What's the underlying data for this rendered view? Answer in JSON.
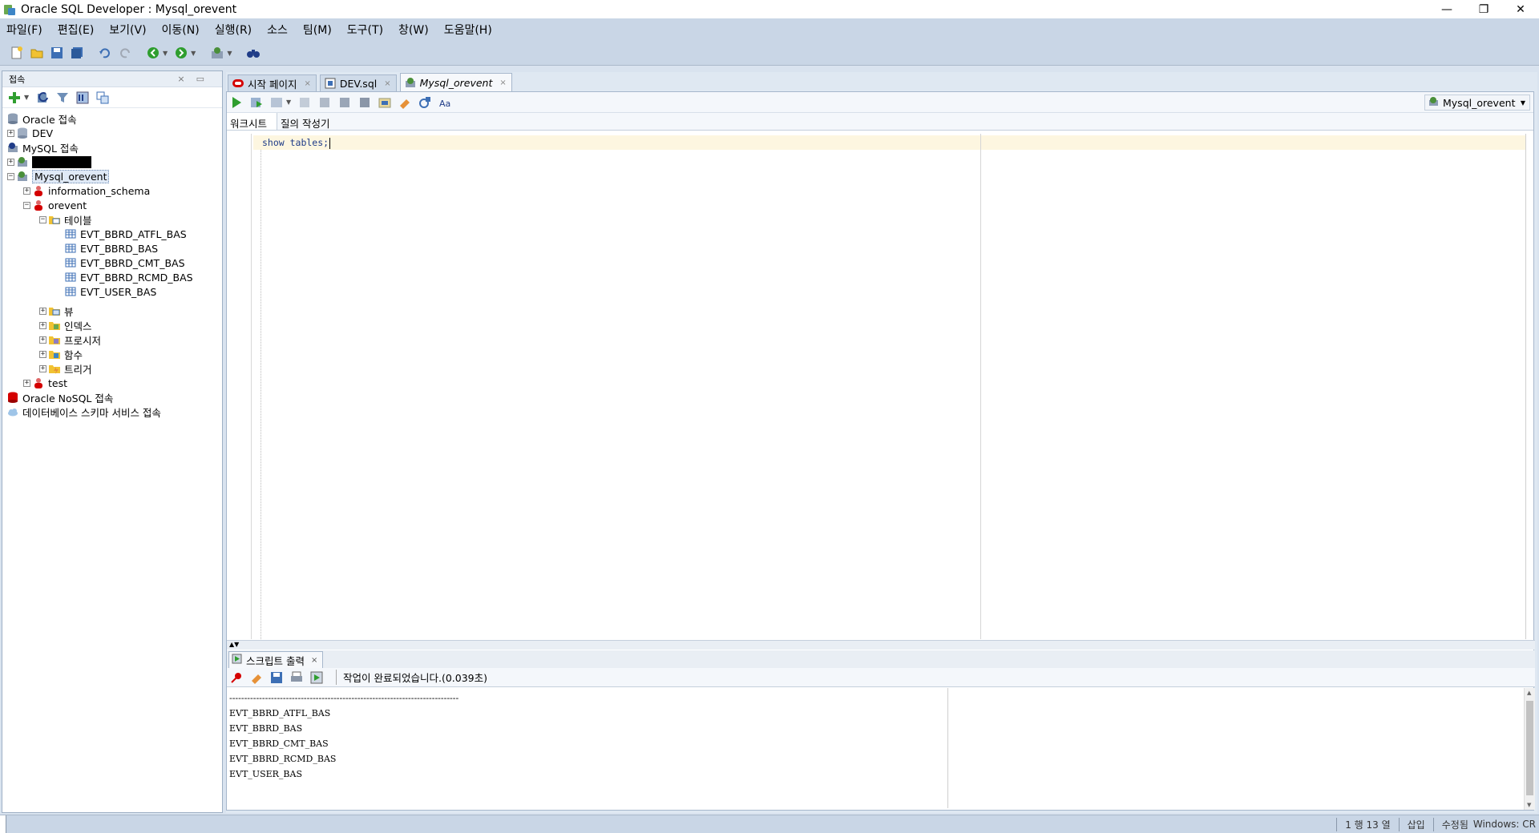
{
  "window": {
    "title": "Oracle SQL Developer : Mysql_orevent",
    "minimize": "—",
    "restore": "❐",
    "close": "✕"
  },
  "menu": [
    "파일(F)",
    "편집(E)",
    "보기(V)",
    "이동(N)",
    "실행(R)",
    "소스",
    "팀(M)",
    "도구(T)",
    "창(W)",
    "도움말(H)"
  ],
  "connections_panel": {
    "title": "접속",
    "tree": [
      {
        "label": "Oracle 접속",
        "level": 0,
        "expander": "",
        "icon": "oracle-db-icon"
      },
      {
        "label": "DEV",
        "level": 0,
        "expander": "+",
        "icon": "database-icon"
      },
      {
        "label": "MySQL 접속",
        "level": 0,
        "expander": "",
        "icon": "mysql-connection-icon"
      },
      {
        "label": "",
        "level": 0,
        "expander": "+",
        "icon": "connection-icon",
        "redacted": true
      },
      {
        "label": "Mysql_orevent",
        "level": 0,
        "expander": "−",
        "icon": "connection-icon",
        "selected": true
      },
      {
        "label": "information_schema",
        "level": 1,
        "expander": "+",
        "icon": "schema-user-icon"
      },
      {
        "label": "orevent",
        "level": 1,
        "expander": "−",
        "icon": "schema-user-icon"
      },
      {
        "label": "테이블",
        "level": 2,
        "expander": "−",
        "icon": "folder-table-icon"
      },
      {
        "label": "EVT_BBRD_ATFL_BAS",
        "level": 3,
        "expander": "",
        "icon": "table-icon"
      },
      {
        "label": "EVT_BBRD_BAS",
        "level": 3,
        "expander": "",
        "icon": "table-icon"
      },
      {
        "label": "EVT_BBRD_CMT_BAS",
        "level": 3,
        "expander": "",
        "icon": "table-icon"
      },
      {
        "label": "EVT_BBRD_RCMD_BAS",
        "level": 3,
        "expander": "",
        "icon": "table-icon"
      },
      {
        "label": "EVT_USER_BAS",
        "level": 3,
        "expander": "",
        "icon": "table-icon"
      },
      {
        "label": "뷰",
        "level": 2,
        "expander": "+",
        "icon": "folder-view-icon"
      },
      {
        "label": "인덱스",
        "level": 2,
        "expander": "+",
        "icon": "folder-index-icon"
      },
      {
        "label": "프로시저",
        "level": 2,
        "expander": "+",
        "icon": "folder-procedure-icon"
      },
      {
        "label": "함수",
        "level": 2,
        "expander": "+",
        "icon": "folder-function-icon"
      },
      {
        "label": "트리거",
        "level": 2,
        "expander": "+",
        "icon": "folder-trigger-icon"
      },
      {
        "label": "test",
        "level": 1,
        "expander": "+",
        "icon": "schema-user-icon"
      },
      {
        "label": "Oracle NoSQL 접속",
        "level": 0,
        "expander": "",
        "icon": "nosql-icon"
      },
      {
        "label": "데이터베이스 스키마 서비스 접속",
        "level": 0,
        "expander": "",
        "icon": "cloud-icon"
      }
    ]
  },
  "doc_tabs": [
    {
      "label": "시작 페이지",
      "icon": "oracle-start-icon",
      "active": false
    },
    {
      "label": "DEV.sql",
      "icon": "sql-file-icon",
      "active": false
    },
    {
      "label": "Mysql_orevent",
      "icon": "connection-icon",
      "active": true
    }
  ],
  "tab_close": "×",
  "editor": {
    "connection_selector": "Mysql_orevent",
    "subtabs": [
      "워크시트",
      "질의 작성기"
    ],
    "code": "show tables;"
  },
  "output": {
    "tab_label": "스크립트 출력",
    "status_text": "작업이 완료되었습니다.(0.039초)",
    "lines": [
      "-----------------------------------------------------------------------------",
      "EVT_BBRD_ATFL_BAS",
      "EVT_BBRD_BAS",
      "EVT_BBRD_CMT_BAS",
      "EVT_BBRD_RCMD_BAS",
      "EVT_USER_BAS"
    ]
  },
  "statusbar": {
    "position": "1 행 13 열",
    "mode": "삽입",
    "modified": "수정됨",
    "line_ending": "Windows: CR"
  },
  "colors": {
    "chrome": "#c9d6e6",
    "accent_green": "#2f9e2f",
    "oracle_red": "#d40000",
    "code_keyword": "#1f3c88"
  }
}
